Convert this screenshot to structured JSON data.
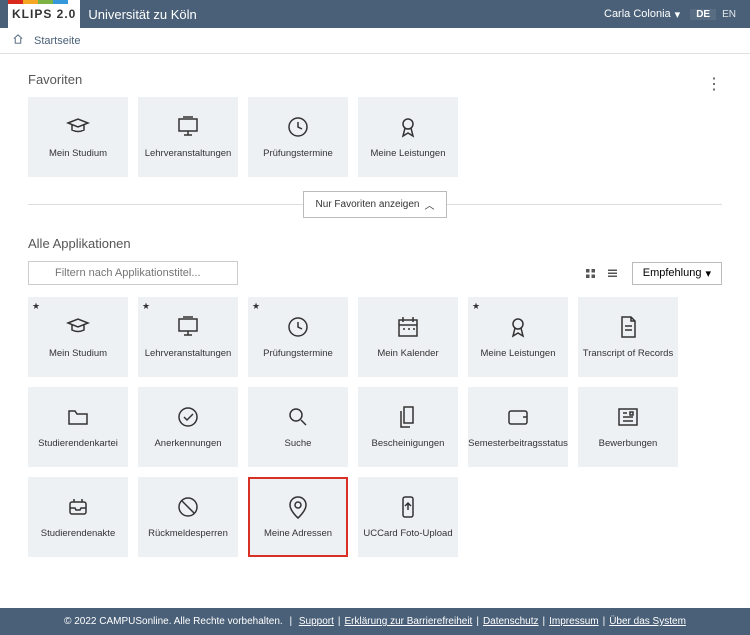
{
  "header": {
    "logo_text": "KLIPS 2.0",
    "university": "Universität zu Köln",
    "user_name": "Carla Colonia",
    "lang_de": "DE",
    "lang_en": "EN",
    "logo_stripe_colors": [
      "#d9291c",
      "#f5a623",
      "#7cb342",
      "#3498db"
    ]
  },
  "breadcrumb": {
    "start": "Startseite"
  },
  "favorites": {
    "title": "Favoriten",
    "tiles": [
      {
        "label": "Mein Studium",
        "icon": "graduation-cap-icon"
      },
      {
        "label": "Lehrveranstaltungen",
        "icon": "presentation-icon"
      },
      {
        "label": "Prüfungstermine",
        "icon": "clock-icon"
      },
      {
        "label": "Meine Leistungen",
        "icon": "award-icon"
      }
    ],
    "toggle_label": "Nur Favoriten anzeigen"
  },
  "all_apps": {
    "title": "Alle Applikationen",
    "filter_placeholder": "Filtern nach Applikationstitel...",
    "sort_label": "Empfehlung",
    "tiles": [
      {
        "label": "Mein Studium",
        "icon": "graduation-cap-icon",
        "starred": true
      },
      {
        "label": "Lehrveranstaltungen",
        "icon": "presentation-icon",
        "starred": true
      },
      {
        "label": "Prüfungstermine",
        "icon": "clock-icon",
        "starred": true
      },
      {
        "label": "Mein Kalender",
        "icon": "calendar-icon",
        "starred": false
      },
      {
        "label": "Meine Leistungen",
        "icon": "award-icon",
        "starred": true
      },
      {
        "label": "Transcript of Records",
        "icon": "document-icon",
        "starred": false
      },
      {
        "label": "Studierendenkartei",
        "icon": "folder-icon",
        "starred": false
      },
      {
        "label": "Anerkennungen",
        "icon": "check-circle-icon",
        "starred": false
      },
      {
        "label": "Suche",
        "icon": "search-icon",
        "starred": false
      },
      {
        "label": "Bescheinigungen",
        "icon": "files-icon",
        "starred": false
      },
      {
        "label": "Semesterbeitragsstatus",
        "icon": "wallet-icon",
        "starred": false
      },
      {
        "label": "Bewerbungen",
        "icon": "newspaper-icon",
        "starred": false
      },
      {
        "label": "Studierendenakte",
        "icon": "inbox-icon",
        "starred": false
      },
      {
        "label": "Rückmeldesperren",
        "icon": "ban-icon",
        "starred": false
      },
      {
        "label": "Meine Adressen",
        "icon": "pin-icon",
        "starred": false,
        "highlight": true
      },
      {
        "label": "UCCard Foto-Upload",
        "icon": "phone-upload-icon",
        "starred": false
      }
    ]
  },
  "footer": {
    "copyright": "© 2022 CAMPUSonline. Alle Rechte vorbehalten.",
    "links": [
      "Support",
      "Erklärung zur Barrierefreiheit",
      "Datenschutz",
      "Impressum",
      "Über das System"
    ]
  }
}
